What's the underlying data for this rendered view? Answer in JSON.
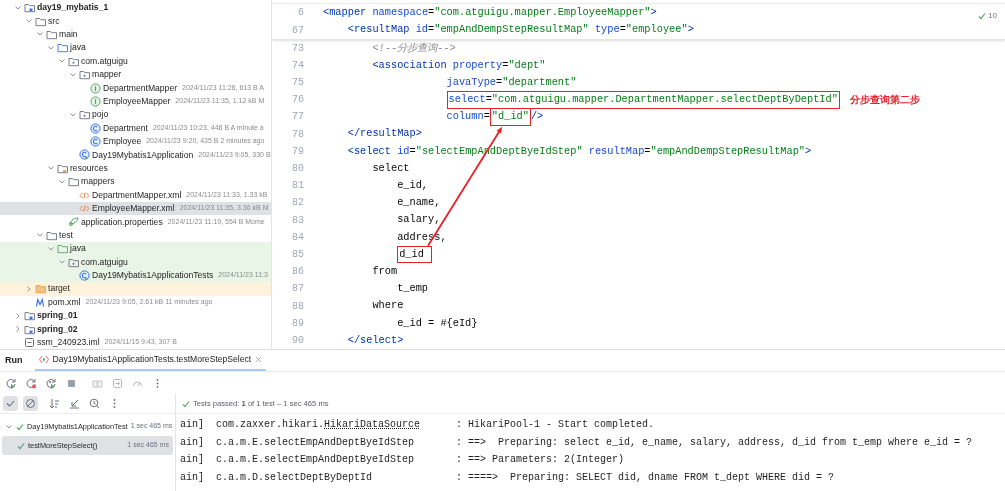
{
  "project_tree": [
    {
      "label": "day19_mybatis_1",
      "kind": "module",
      "expanded": true,
      "selected": false,
      "children": [
        {
          "label": "src",
          "kind": "folder",
          "expanded": true,
          "selected": false,
          "children": [
            {
              "label": "main",
              "kind": "folder",
              "expanded": true,
              "selected": false,
              "children": [
                {
                  "label": "java",
                  "kind": "source-folder",
                  "expanded": true,
                  "selected": false,
                  "children": [
                    {
                      "label": "com.atguigu",
                      "kind": "package",
                      "expanded": true,
                      "selected": false,
                      "children": [
                        {
                          "label": "mapper",
                          "kind": "package",
                          "expanded": true,
                          "selected": false,
                          "children": [
                            {
                              "label": "DepartmentMapper",
                              "kind": "interface",
                              "meta": "2024/11/23 11:28, 613 B A",
                              "selected": false
                            },
                            {
                              "label": "EmployeeMapper",
                              "kind": "interface",
                              "meta": "2024/11/23 11:35, 1.12 kB M",
                              "selected": false
                            }
                          ]
                        },
                        {
                          "label": "pojo",
                          "kind": "package",
                          "expanded": true,
                          "selected": false,
                          "children": [
                            {
                              "label": "Department",
                              "kind": "class",
                              "meta": "2024/11/23 10:23, 448 B A minute a",
                              "selected": false
                            },
                            {
                              "label": "Employee",
                              "kind": "class",
                              "meta": "2024/11/23 9:20, 435 B 2 minutes ago",
                              "selected": false
                            }
                          ]
                        },
                        {
                          "label": "Day19Mybatis1Application",
                          "kind": "app",
                          "meta": "2024/11/23 9:05, 330 B",
                          "selected": false
                        }
                      ]
                    }
                  ]
                },
                {
                  "label": "resources",
                  "kind": "resources-folder",
                  "expanded": true,
                  "selected": false,
                  "children": [
                    {
                      "label": "mappers",
                      "kind": "folder",
                      "expanded": true,
                      "selected": false,
                      "children": [
                        {
                          "label": "DepartmentMapper.xml",
                          "kind": "xml",
                          "meta": "2024/11/23 11:33, 1.33 kB",
                          "selected": false
                        },
                        {
                          "label": "EmployeeMapper.xml",
                          "kind": "xml",
                          "meta": "2024/11/23 11:35, 3.36 kB M",
                          "selected": true
                        }
                      ]
                    },
                    {
                      "label": "application.properties",
                      "kind": "properties",
                      "meta": "2024/11/23 11:19, 554 B Mome",
                      "selected": false
                    }
                  ]
                }
              ]
            },
            {
              "label": "test",
              "kind": "folder",
              "expanded": true,
              "selected": false,
              "children": [
                {
                  "label": "java",
                  "kind": "test-folder",
                  "expanded": true,
                  "selected": false,
                  "children": [
                    {
                      "label": "com.atguigu",
                      "kind": "package",
                      "expanded": true,
                      "selected": false,
                      "children": [
                        {
                          "label": "Day19Mybatis1ApplicationTests",
                          "kind": "app",
                          "meta": "2024/11/23 11:3",
                          "selected": false
                        }
                      ]
                    }
                  ]
                }
              ]
            }
          ]
        },
        {
          "label": "target",
          "kind": "excluded-folder",
          "expanded": false,
          "selected": false
        },
        {
          "label": "pom.xml",
          "kind": "maven",
          "meta": "2024/11/23 9:05, 2.61 kB 11 minutes ago",
          "selected": false
        }
      ]
    },
    {
      "label": "spring_01",
      "kind": "module",
      "expanded": false,
      "selected": false
    },
    {
      "label": "spring_02",
      "kind": "module",
      "expanded": false,
      "selected": false
    },
    {
      "label": "ssm_240923.iml",
      "kind": "iml",
      "meta": "2024/11/15 9:43, 307 B",
      "selected": false
    }
  ],
  "editor": {
    "inspection_count": "10",
    "sticky_lines": [
      {
        "number": "6",
        "segments": [
          {
            "kind": "tag",
            "text": "<mapper"
          },
          {
            "kind": "attr",
            "text": " namespace"
          },
          {
            "kind": "plain",
            "text": "="
          },
          {
            "kind": "value",
            "text": "\"com.atguigu.mapper.EmployeeMapper\""
          },
          {
            "kind": "tag",
            "text": ">"
          }
        ]
      },
      {
        "number": "67",
        "segments": [
          {
            "kind": "tag",
            "text": "    <resultMap"
          },
          {
            "kind": "attr",
            "text": " id"
          },
          {
            "kind": "plain",
            "text": "="
          },
          {
            "kind": "value",
            "text": "\"empAndDempStepResultMap\""
          },
          {
            "kind": "attr",
            "text": " type"
          },
          {
            "kind": "plain",
            "text": "="
          },
          {
            "kind": "value",
            "text": "\"employee\""
          },
          {
            "kind": "tag",
            "text": ">"
          }
        ]
      }
    ],
    "lines": [
      {
        "number": "73",
        "segments": [
          {
            "kind": "comment",
            "text": "        <!--分步查询-->"
          }
        ]
      },
      {
        "number": "74",
        "segments": [
          {
            "kind": "tag",
            "text": "        <association"
          },
          {
            "kind": "attr",
            "text": " property"
          },
          {
            "kind": "plain",
            "text": "="
          },
          {
            "kind": "value",
            "text": "\"dept\""
          }
        ]
      },
      {
        "number": "75",
        "segments": [
          {
            "kind": "attr",
            "text": "                    javaType"
          },
          {
            "kind": "plain",
            "text": "="
          },
          {
            "kind": "value",
            "text": "\"department\""
          }
        ]
      },
      {
        "number": "76",
        "segments": [
          {
            "kind": "attr",
            "text": "select",
            "boxed": true
          },
          {
            "kind": "plain",
            "text": "=",
            "boxed": true
          },
          {
            "kind": "value",
            "text": "\"com.atguigu.mapper.DepartmentMapper.selectDeptByDeptId\"",
            "boxed": true
          }
        ],
        "note": "分步查询第二步"
      },
      {
        "number": "77",
        "segments": [
          {
            "kind": "attr",
            "text": "                    column"
          },
          {
            "kind": "plain",
            "text": "="
          },
          {
            "kind": "value",
            "text": "\"d_id\"",
            "boxed": true
          },
          {
            "kind": "tag",
            "text": "/>"
          }
        ]
      },
      {
        "number": "78",
        "segments": [
          {
            "kind": "tag",
            "text": "    </resultMap>"
          }
        ]
      },
      {
        "number": "79",
        "segments": [
          {
            "kind": "tag",
            "text": "    <select"
          },
          {
            "kind": "attr",
            "text": " id"
          },
          {
            "kind": "plain",
            "text": "="
          },
          {
            "kind": "value",
            "text": "\"selectEmpAndDeptByeIdStep\""
          },
          {
            "kind": "attr",
            "text": " resultMap"
          },
          {
            "kind": "plain",
            "text": "="
          },
          {
            "kind": "value",
            "text": "\"empAndDempStepResultMap\""
          },
          {
            "kind": "tag",
            "text": ">"
          }
        ]
      },
      {
        "number": "80",
        "segments": [
          {
            "kind": "plain",
            "text": "        select"
          }
        ]
      },
      {
        "number": "81",
        "segments": [
          {
            "kind": "plain",
            "text": "            e_id,"
          }
        ]
      },
      {
        "number": "82",
        "segments": [
          {
            "kind": "plain",
            "text": "            e_name,"
          }
        ]
      },
      {
        "number": "83",
        "segments": [
          {
            "kind": "plain",
            "text": "            salary,"
          }
        ]
      },
      {
        "number": "84",
        "segments": [
          {
            "kind": "plain",
            "text": "            address,"
          }
        ]
      },
      {
        "number": "85",
        "segments": [
          {
            "kind": "plain",
            "text": "d_id ",
            "boxed": true,
            "arrow_start": true
          }
        ]
      },
      {
        "number": "86",
        "segments": [
          {
            "kind": "plain",
            "text": "        from"
          }
        ]
      },
      {
        "number": "87",
        "segments": [
          {
            "kind": "plain",
            "text": "            t_emp"
          }
        ]
      },
      {
        "number": "88",
        "segments": [
          {
            "kind": "plain",
            "text": "        where"
          }
        ]
      },
      {
        "number": "89",
        "segments": [
          {
            "kind": "plain",
            "text": "            e_id = #{eId}"
          }
        ]
      },
      {
        "number": "90",
        "segments": [
          {
            "kind": "tag",
            "text": "    </"
          },
          {
            "kind": "keyword",
            "text": "select"
          },
          {
            "kind": "tag",
            "text": ">"
          }
        ]
      }
    ]
  },
  "run_panel": {
    "title": "Run",
    "tabs": [
      {
        "label": "Day19Mybatis1ApplicationTests.testMoreStepSelect",
        "selected": true
      }
    ],
    "status": "Tests passed: **1** of 1 test – 1 sec 465 ms",
    "tests": [
      {
        "label": "Day19Mybatis1ApplicationTest",
        "duration": "1 sec 465 ms",
        "passed": true,
        "selected": false,
        "children": [
          {
            "label": "testMoreStepSelect()",
            "duration": "1 sec 465 ms",
            "passed": true,
            "selected": true
          }
        ]
      }
    ],
    "console": [
      {
        "thread": "ain]",
        "logger": "com.zaxxer.hikari.",
        "logger_class": "HikariDataSource",
        "message": ": HikariPool-1 - Start completed."
      },
      {
        "thread": "ain]",
        "logger": "c.a.m.E.selectEmpAndDeptByeIdStep",
        "message": ": ==>  Preparing: select e_id, e_name, salary, address, d_id from t_emp where e_id = ?"
      },
      {
        "thread": "ain]",
        "logger": "c.a.m.E.selectEmpAndDeptByeIdStep",
        "message": ": ==> Parameters: 2(Integer)"
      },
      {
        "thread": "ain]",
        "logger": "c.a.m.D.selectDeptByDeptId",
        "message": ": ====>  Preparing: SELECT did, dname FROM t_dept WHERE did = ?"
      }
    ]
  }
}
